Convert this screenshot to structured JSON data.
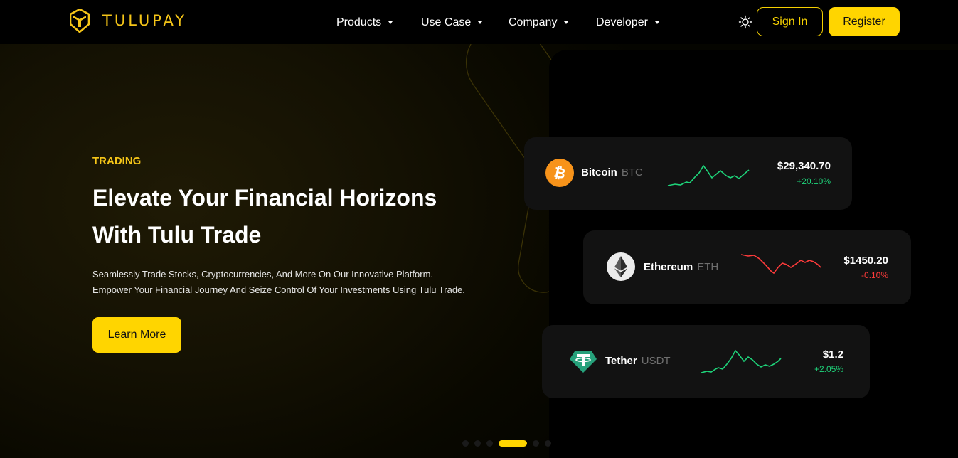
{
  "brand": {
    "name": "TULUPAY",
    "accent": "#f5c518",
    "button_yellow": "#ffd500",
    "up_color": "#1ed47a",
    "down_color": "#ff3b3b"
  },
  "nav": {
    "items": [
      {
        "label": "Products"
      },
      {
        "label": "Use Case"
      },
      {
        "label": "Company"
      },
      {
        "label": "Developer"
      }
    ],
    "theme_icon": "sun-icon",
    "sign_in": "Sign In",
    "register": "Register"
  },
  "hero": {
    "eyebrow": "TRADING",
    "headline": "Elevate Your Financial Horizons With Tulu Trade",
    "subtext_line1": "Seamlessly Trade Stocks, Cryptocurrencies, And More On Our Innovative Platform.",
    "subtext_line2": "Empower Your Financial Journey And Seize Control Of Your Investments Using Tulu Trade.",
    "cta": "Learn More"
  },
  "coins": [
    {
      "name": "Bitcoin",
      "symbol": "BTC",
      "price": "$29,340.70",
      "change": "+20.10%",
      "trend": "up",
      "icon": "bitcoin-icon"
    },
    {
      "name": "Ethereum",
      "symbol": "ETH",
      "price": "$1450.20",
      "change": "-0.10%",
      "trend": "down",
      "icon": "ethereum-icon"
    },
    {
      "name": "Tether",
      "symbol": "USDT",
      "price": "$1.2",
      "change": "+2.05%",
      "trend": "up",
      "icon": "tether-icon"
    }
  ],
  "carousel": {
    "slide_count": 6,
    "active_index": 3
  }
}
